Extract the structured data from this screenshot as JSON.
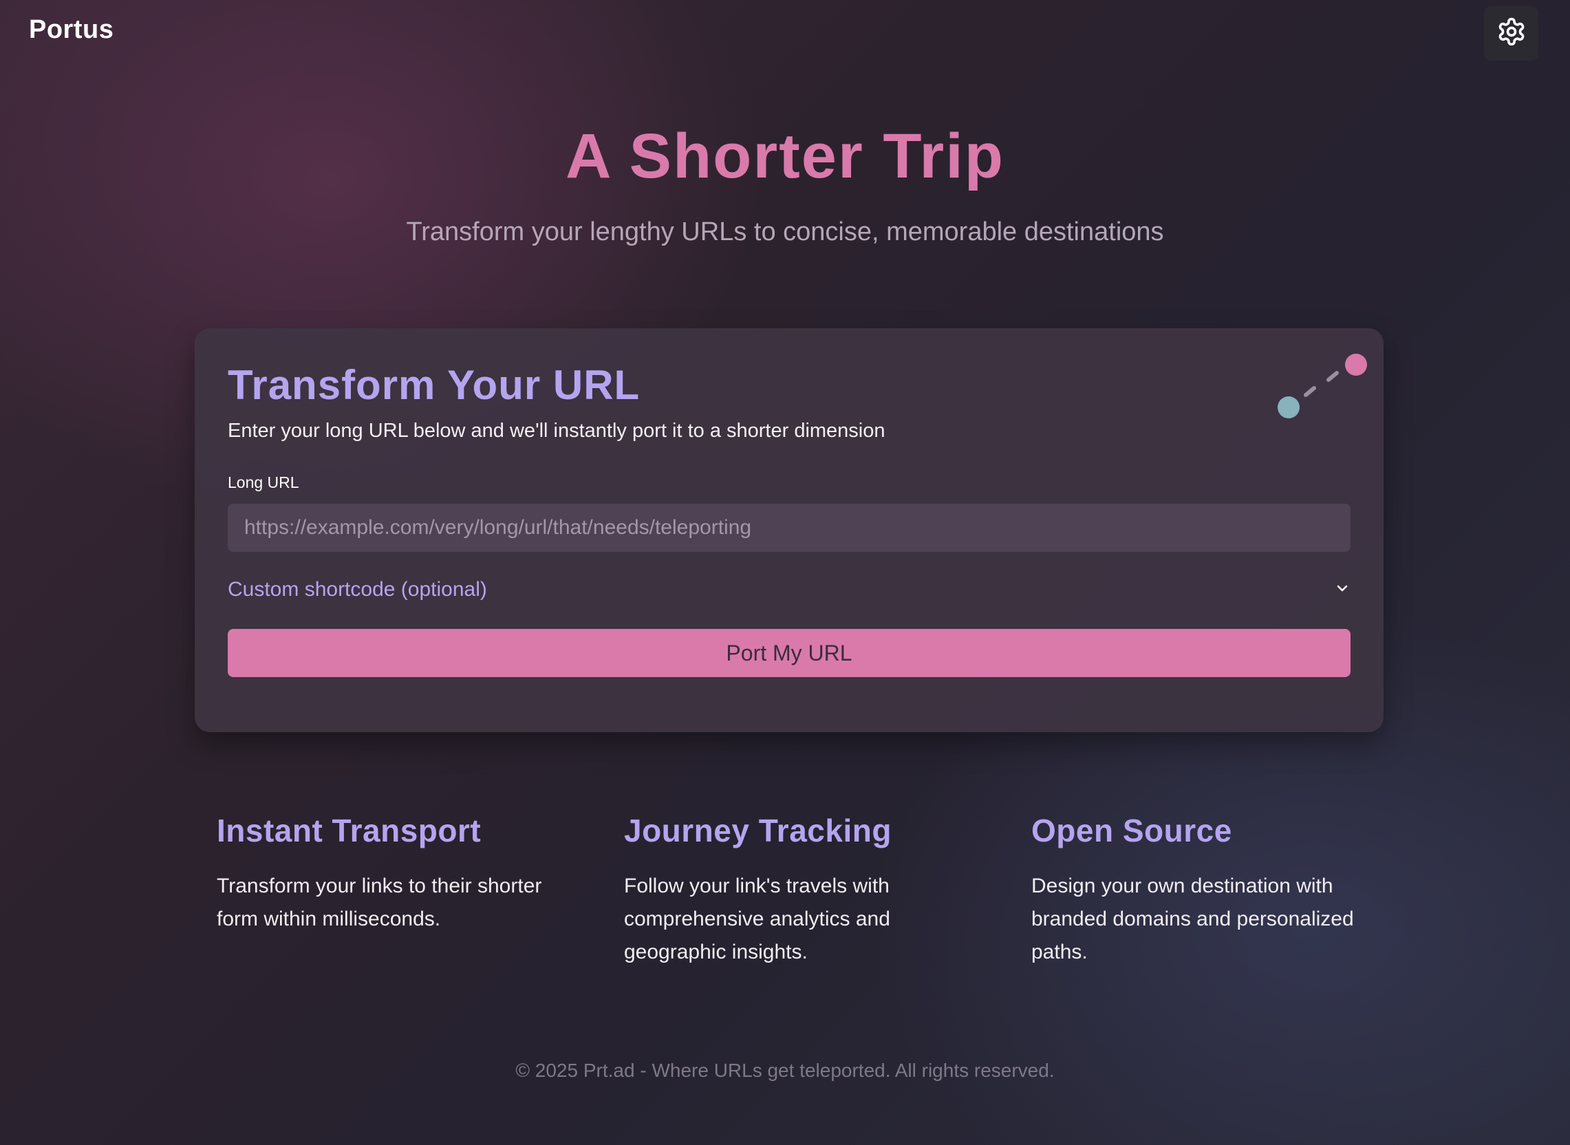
{
  "header": {
    "logo": "Portus",
    "settings_icon": "gear-icon"
  },
  "hero": {
    "title": "A Shorter Trip",
    "subtitle": "Transform your lengthy URLs to concise, memorable destinations"
  },
  "card": {
    "title": "Transform Your URL",
    "description": "Enter your long URL below and we'll instantly port it to a shorter dimension",
    "url_label": "Long URL",
    "url_placeholder": "https://example.com/very/long/url/that/needs/teleporting",
    "url_value": "",
    "shortcode_label": "Custom shortcode (optional)",
    "shortcode_icon": "chevron-down-icon",
    "submit_label": "Port My URL",
    "decoration_icon": "teleport-dots-icon"
  },
  "features": [
    {
      "title": "Instant Transport",
      "text": "Transform your links to their shorter form within milliseconds."
    },
    {
      "title": "Journey Tracking",
      "text": "Follow your link's travels with comprehensive analytics and geographic insights."
    },
    {
      "title": "Open Source",
      "text": "Design your own destination with branded domains and personalized paths."
    }
  ],
  "footer": {
    "text": "© 2025 Prt.ad - Where URLs get teleported. All rights reserved."
  },
  "colors": {
    "accent_pink": "#d97aab",
    "accent_purple": "#b5a4ef",
    "accent_teal": "#87b3bd"
  }
}
